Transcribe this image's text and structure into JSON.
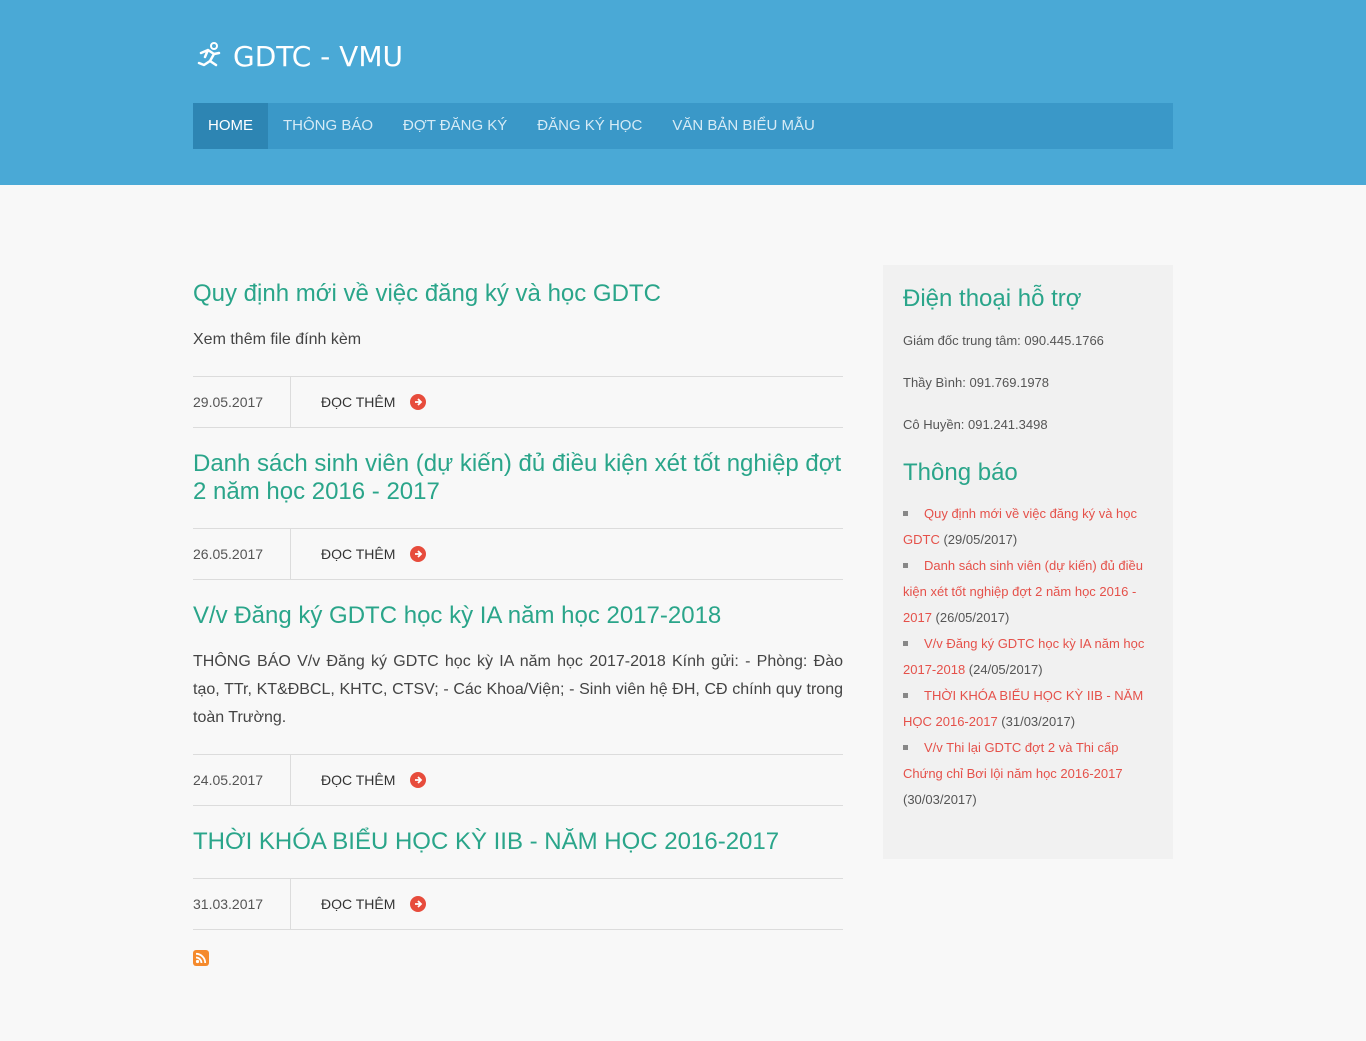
{
  "site": {
    "title": "GDTC - VMU"
  },
  "nav": [
    {
      "label": "HOME",
      "active": true
    },
    {
      "label": "THÔNG BÁO",
      "active": false
    },
    {
      "label": "ĐỢT ĐĂNG KÝ",
      "active": false
    },
    {
      "label": "ĐĂNG KÝ HỌC",
      "active": false
    },
    {
      "label": "VĂN BẢN BIỂU MẪU",
      "active": false
    }
  ],
  "articles": [
    {
      "title": "Quy định mới về việc đăng ký và học GDTC",
      "body": "Xem thêm file đính kèm",
      "date": "29.05.2017",
      "more": "ĐỌC THÊM"
    },
    {
      "title": "Danh sách sinh viên (dự kiến) đủ điều kiện xét tốt nghiệp đợt 2 năm học 2016 - 2017",
      "body": "",
      "date": "26.05.2017",
      "more": "ĐỌC THÊM"
    },
    {
      "title": "V/v Đăng ký GDTC học kỳ IA năm học 2017-2018",
      "body": "THÔNG BÁO V/v Đăng ký GDTC học kỳ IA năm học 2017-2018             Kính gửi:  - Phòng: Đào tạo, TTr, KT&ĐBCL, KHTC, CTSV;                 - Các Khoa/Viện;                     - Sinh viên hệ ĐH, CĐ chính quy trong toàn Trường.",
      "date": "24.05.2017",
      "more": "ĐỌC THÊM"
    },
    {
      "title": "THỜI KHÓA BIỂU HỌC KỲ IIB - NĂM HỌC 2016-2017",
      "body": "",
      "date": "31.03.2017",
      "more": "ĐỌC THÊM"
    }
  ],
  "sidebar": {
    "support_title": "Điện thoại hỗ trợ",
    "phones": [
      "Giám đốc trung tâm: 090.445.1766",
      "Thầy Bình: 091.769.1978",
      "Cô Huyền: 091.241.3498"
    ],
    "news_title": "Thông báo",
    "news": [
      {
        "link": "Quy định mới về việc đăng ký và học GDTC",
        "date": "(29/05/2017)"
      },
      {
        "link": "Danh sách sinh viên (dự kiến) đủ điều kiện xét tốt nghiệp đợt 2 năm học 2016 - 2017",
        "date": "(26/05/2017)"
      },
      {
        "link": "V/v Đăng ký GDTC học kỳ IA năm học 2017-2018",
        "date": "(24/05/2017)"
      },
      {
        "link": "THỜI KHÓA BIỂU HỌC KỲ IIB - NĂM HỌC 2016-2017",
        "date": "(31/03/2017)"
      },
      {
        "link": "V/v Thi lại GDTC đợt 2 và Thi cấp Chứng chỉ Bơi lội năm học 2016-2017",
        "date": "(30/03/2017)"
      }
    ]
  },
  "colors": {
    "header": "#4aa9d6",
    "nav": "#3a98c8",
    "accent": "#2aa58a",
    "link": "#e5514a"
  },
  "icons": {
    "logo": "runner-icon",
    "more": "arrow-circle-right-icon",
    "feed": "rss-icon"
  }
}
